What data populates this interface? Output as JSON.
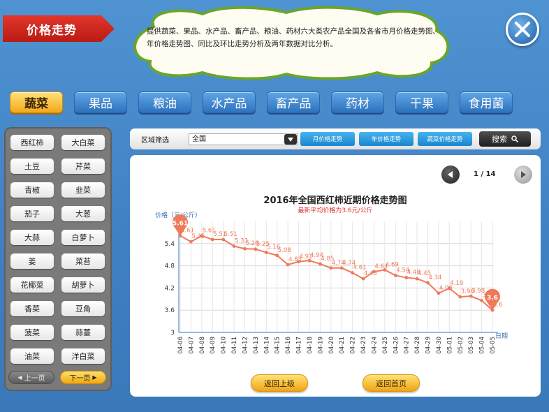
{
  "header": {
    "title": "价格走势",
    "description": "提供蔬菜、果品、水产品、畜产品、粮油、药材六大类农产品全国及各省市月价格走势图、年价格走势图、同比及环比走势分析及两年数据对比分析。"
  },
  "tabs": [
    {
      "label": "蔬菜",
      "active": true
    },
    {
      "label": "果品",
      "active": false
    },
    {
      "label": "粮油",
      "active": false
    },
    {
      "label": "水产品",
      "active": false
    },
    {
      "label": "畜产品",
      "active": false
    },
    {
      "label": "药材",
      "active": false
    },
    {
      "label": "干果",
      "active": false
    },
    {
      "label": "食用菌",
      "active": false
    }
  ],
  "vegetables": [
    "西红柿",
    "大白菜",
    "土豆",
    "芹菜",
    "青椒",
    "韭菜",
    "茄子",
    "大葱",
    "大蒜",
    "白萝卜",
    "姜",
    "菜苔",
    "花椰菜",
    "胡萝卜",
    "香菜",
    "豆角",
    "菠菜",
    "蒜薹",
    "油菜",
    "洋白菜"
  ],
  "veg_pager": {
    "prev": "上一页",
    "next": "下一页"
  },
  "filter": {
    "label": "区域筛选",
    "region": "全国",
    "buttons": [
      "月价格走势",
      "年价格走势",
      "蔬菜价格走势"
    ],
    "search": "搜索"
  },
  "pager": {
    "text": "1 / 14"
  },
  "chart_data": {
    "type": "line",
    "title": "2016年全国西红柿近期价格走势图",
    "subtitle": "最新平均价格为3.6元/公斤",
    "ylabel": "价格（元/公斤）",
    "xlabel": "日期",
    "ylim": [
      3,
      6
    ],
    "yticks": [
      3,
      3.6,
      4.2,
      4.8,
      5.4
    ],
    "grid": true,
    "color": "#ef7a5a",
    "x": [
      "04-06",
      "04-07",
      "04-08",
      "04-09",
      "04-10",
      "04-11",
      "04-12",
      "04-13",
      "04-14",
      "04-15",
      "04-16",
      "04-17",
      "04-18",
      "04-19",
      "04-20",
      "04-21",
      "04-22",
      "04-23",
      "04-24",
      "04-25",
      "04-26",
      "04-27",
      "04-28",
      "04-29",
      "04-30",
      "05-01",
      "05-02",
      "05-03",
      "05-04",
      "05-05"
    ],
    "values": [
      5.61,
      5.45,
      5.61,
      5.51,
      5.51,
      5.33,
      5.26,
      5.25,
      5.16,
      5.08,
      4.83,
      4.91,
      4.94,
      4.85,
      4.74,
      4.74,
      4.61,
      4.45,
      4.64,
      4.69,
      4.54,
      4.48,
      4.45,
      4.34,
      4.06,
      4.19,
      3.96,
      3.98,
      3.86,
      3.6
    ],
    "highlight": [
      {
        "x": "04-06",
        "value": 5.61
      },
      {
        "x": "05-05",
        "value": 3.6
      }
    ]
  },
  "actions": {
    "back": "返回上级",
    "home": "返回首页"
  }
}
